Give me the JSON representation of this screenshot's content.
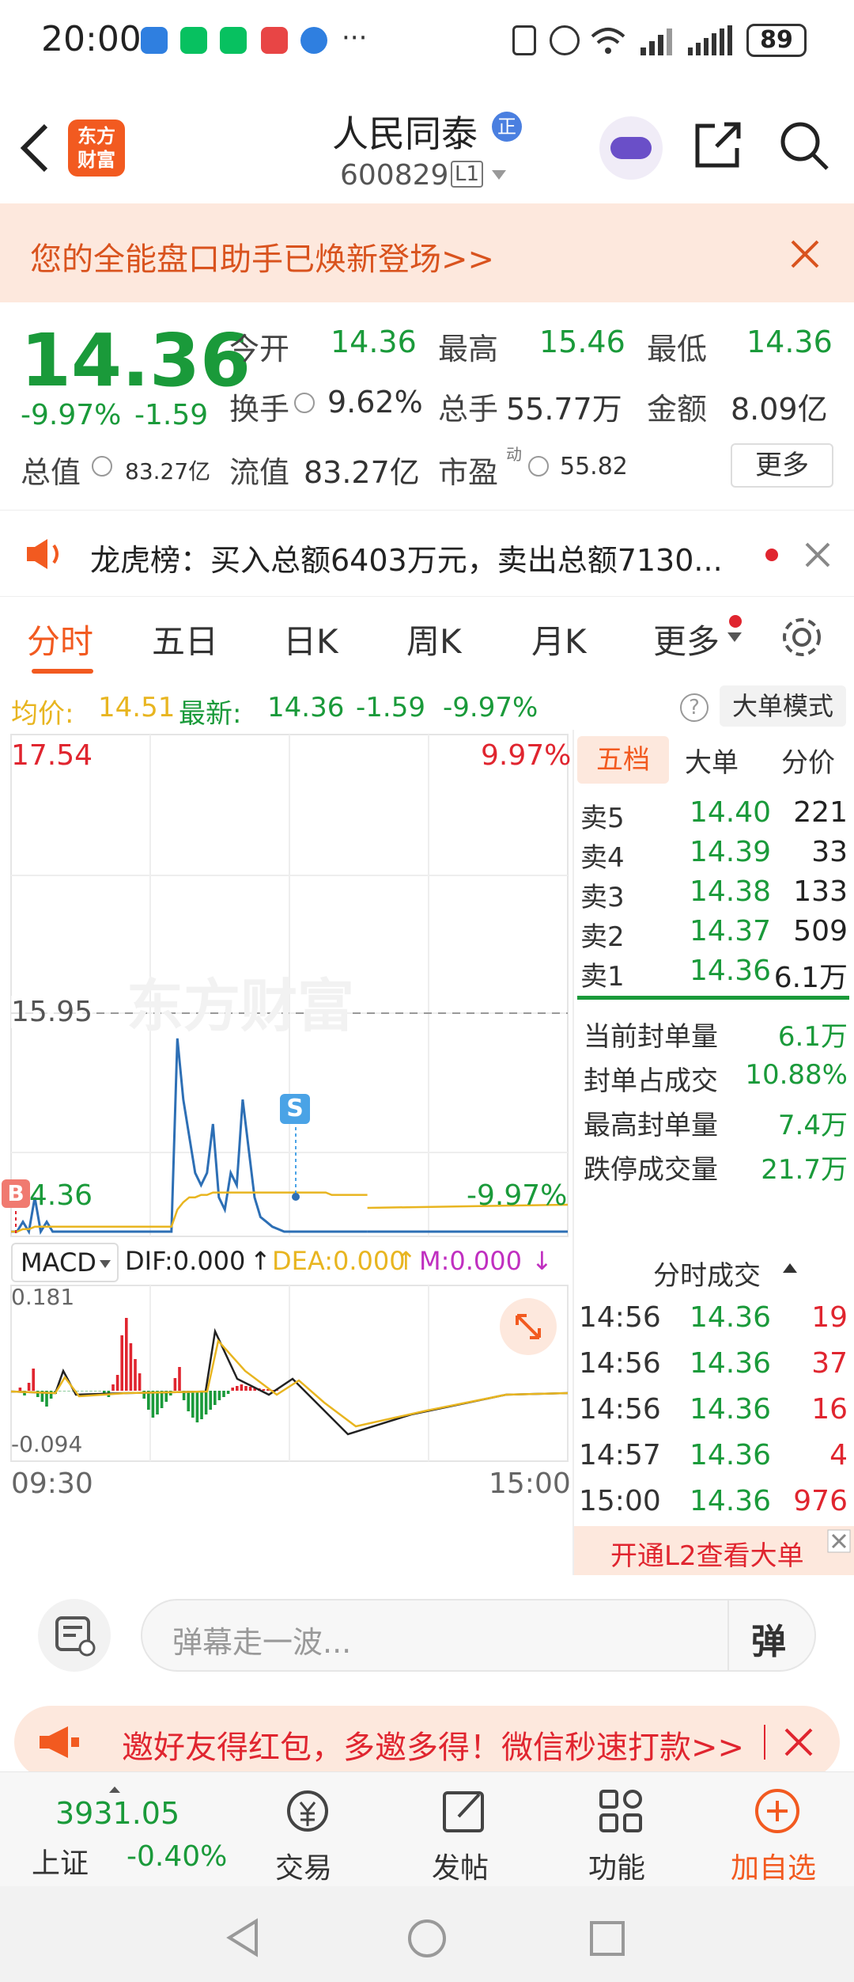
{
  "status": {
    "time": "20:00",
    "battery": "89"
  },
  "header": {
    "logo_text": "东方\n财富",
    "title": "人民同泰",
    "title_badge": "正",
    "code": "600829",
    "level": "L1"
  },
  "banner": {
    "text": "您的全能盘口助手已焕新登场>>"
  },
  "quote": {
    "price": "14.36",
    "change_pct": "-9.97%",
    "change": "-1.59",
    "open_label": "今开",
    "open": "14.36",
    "high_label": "最高",
    "high": "15.46",
    "low_label": "最低",
    "low": "14.36",
    "turnover_label": "换手",
    "turnover": "9.62%",
    "volume_label": "总手",
    "volume": "55.77万",
    "amount_label": "金额",
    "amount": "8.09亿",
    "mktcap_label": "总值",
    "mktcap": "83.27亿",
    "float_label": "流值",
    "float": "83.27亿",
    "pe_label": "市盈",
    "pe_sup": "动",
    "pe": "55.82",
    "more": "更多"
  },
  "lhb": {
    "text": "龙虎榜：买入总额6403万元，卖出总额7130..."
  },
  "tabs": [
    "分时",
    "五日",
    "日K",
    "周K",
    "月K",
    "更多"
  ],
  "infobar": {
    "avg_label": "均价:",
    "avg": "14.51",
    "latest_label": "最新:",
    "latest": "14.36",
    "chg": "-1.59",
    "pct": "-9.97%",
    "mode_btn": "大单模式"
  },
  "chart": {
    "top_price": "17.54",
    "top_pct": "9.97%",
    "mid_price": "15.95",
    "bottom_price": "14.36",
    "bottom_pct": "-9.97%",
    "watermark": "东方财富",
    "buy_marker": "B",
    "sell_marker": "S",
    "time_start": "09:30",
    "time_end": "15:00",
    "macd_label": "MACD",
    "dif": "DIF:0.000",
    "dea": "DEA:0.000",
    "m": "M:0.000",
    "macd_top": "0.181",
    "macd_bottom": "-0.094"
  },
  "chart_data": {
    "type": "line",
    "title": "",
    "series": [
      {
        "name": "最新",
        "values": [
          14.36,
          14.36,
          14.4,
          14.36,
          14.5,
          14.36,
          14.4,
          14.36,
          14.36,
          14.36,
          14.36,
          14.36,
          14.36,
          14.36,
          14.36,
          14.36,
          14.36,
          14.36,
          14.36,
          14.36,
          14.36,
          14.36,
          14.36,
          14.36,
          14.36,
          14.36,
          14.36,
          14.36,
          15.15,
          14.9,
          14.75,
          14.6,
          14.55,
          14.6,
          14.8,
          14.5,
          14.45,
          14.6,
          14.55,
          14.9,
          14.7,
          14.5,
          14.42,
          14.4,
          14.38,
          14.37,
          14.36,
          14.36,
          14.36,
          14.36,
          14.36,
          14.36,
          14.36,
          14.36,
          14.36,
          14.36,
          14.36,
          14.36,
          14.36,
          14.36,
          14.36
        ]
      },
      {
        "name": "均价",
        "values": [
          14.36,
          14.36,
          14.37,
          14.37,
          14.38,
          14.38,
          14.38,
          14.38,
          14.38,
          14.38,
          14.38,
          14.38,
          14.38,
          14.38,
          14.38,
          14.38,
          14.38,
          14.38,
          14.38,
          14.38,
          14.38,
          14.38,
          14.38,
          14.38,
          14.38,
          14.38,
          14.38,
          14.38,
          14.45,
          14.48,
          14.5,
          14.5,
          14.51,
          14.51,
          14.52,
          14.52,
          14.52,
          14.52,
          14.52,
          14.52,
          14.52,
          14.52,
          14.52,
          14.52,
          14.52,
          14.52,
          14.52,
          14.52,
          14.52,
          14.52,
          14.52,
          14.52,
          14.52,
          14.52,
          14.51,
          14.51,
          14.51,
          14.51,
          14.51,
          14.51,
          14.51
        ]
      }
    ],
    "ylim": [
      14.36,
      17.54
    ]
  },
  "order_book": {
    "tabs": [
      "五档",
      "大单",
      "分价"
    ],
    "rows": [
      {
        "label": "卖5",
        "price": "14.40",
        "vol": "221"
      },
      {
        "label": "卖4",
        "price": "14.39",
        "vol": "33"
      },
      {
        "label": "卖3",
        "price": "14.38",
        "vol": "133"
      },
      {
        "label": "卖2",
        "price": "14.37",
        "vol": "509"
      },
      {
        "label": "卖1",
        "price": "14.36",
        "vol": "6.1万"
      }
    ],
    "seal": [
      {
        "label": "当前封单量",
        "val": "6.1万"
      },
      {
        "label": "封单占成交",
        "val": "10.88%"
      },
      {
        "label": "最高封单量",
        "val": "7.4万"
      },
      {
        "label": "跌停成交量",
        "val": "21.7万"
      }
    ],
    "ticks_title": "分时成交",
    "ticks": [
      {
        "t": "14:56",
        "p": "14.36",
        "v": "19"
      },
      {
        "t": "14:56",
        "p": "14.36",
        "v": "37"
      },
      {
        "t": "14:56",
        "p": "14.36",
        "v": "16"
      },
      {
        "t": "14:57",
        "p": "14.36",
        "v": "4"
      },
      {
        "t": "15:00",
        "p": "14.36",
        "v": "976"
      }
    ],
    "l2": "开通L2查看大单"
  },
  "danmu": {
    "placeholder": "弹幕走一波...",
    "btn": "弹"
  },
  "invite": {
    "text": "邀好友得红包，多邀多得！微信秒速打款>>"
  },
  "bottomnav": {
    "index_val": "3931.05",
    "index_name": "上证",
    "index_pct": "-0.40%",
    "trade": "交易",
    "post": "发帖",
    "func": "功能",
    "add": "加自选"
  },
  "colors": {
    "up": "#e0252f",
    "down": "#1a9a3a",
    "brand": "#f25a20",
    "avg_line": "#e8b520",
    "price_line": "#2d6fb5"
  }
}
